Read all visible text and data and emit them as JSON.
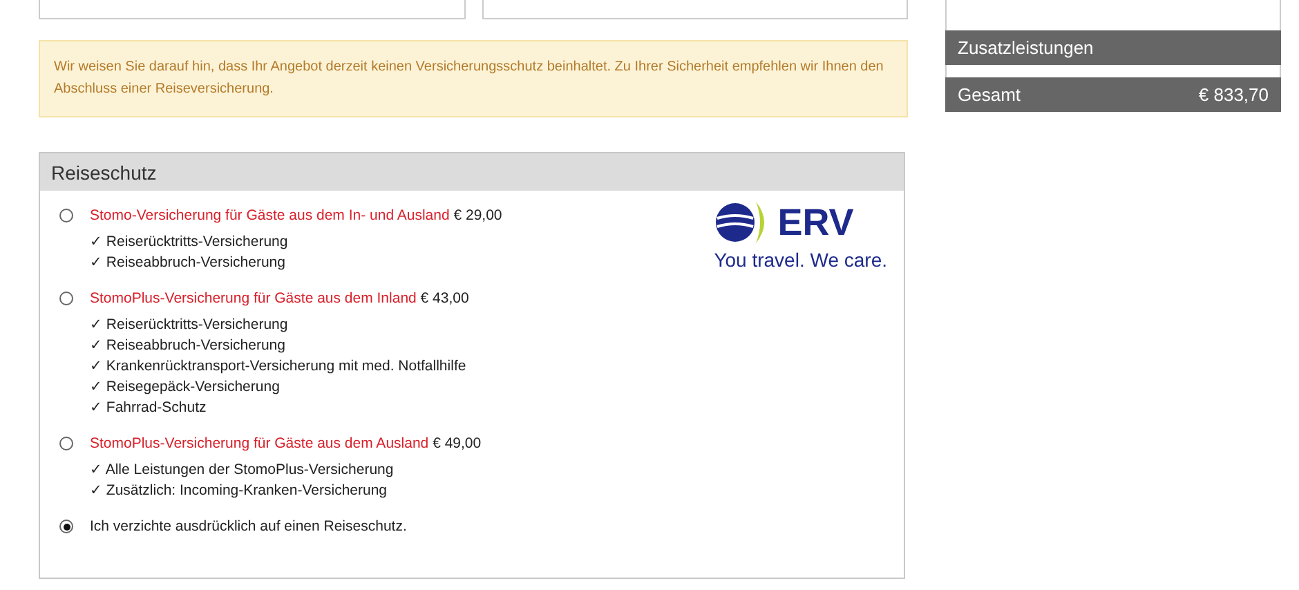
{
  "notice": "Wir weisen Sie darauf hin, dass Ihr Angebot derzeit keinen Versicherungsschutz beinhaltet. Zu Ihrer Sicherheit empfehlen wir Ihnen den Abschluss einer Reiseversicherung.",
  "panel": {
    "title": "Reiseschutz",
    "logo": {
      "name": "ERV",
      "slogan": "You travel. We care."
    },
    "options": [
      {
        "kind": "offer",
        "title": "Stomo-Versicherung für Gäste aus dem In- und Ausland",
        "price": "€ 29,00",
        "selected": false,
        "features": [
          "✓ Reiserücktritts-Versicherung",
          "✓ Reiseabbruch-Versicherung"
        ]
      },
      {
        "kind": "offer",
        "title": "StomoPlus-Versicherung für Gäste aus dem Inland",
        "price": "€ 43,00",
        "selected": false,
        "features": [
          "✓ Reiserücktritts-Versicherung",
          "✓ Reiseabbruch-Versicherung",
          "✓ Krankenrücktransport-Versicherung mit med. Notfallhilfe",
          "✓ Reisegepäck-Versicherung",
          "✓ Fahrrad-Schutz"
        ]
      },
      {
        "kind": "offer",
        "title": "StomoPlus-Versicherung für Gäste aus dem Ausland",
        "price": "€ 49,00",
        "selected": false,
        "features": [
          "✓ Alle Leistungen der StomoPlus-Versicherung",
          "✓ Zusätzlich: Incoming-Kranken-Versicherung"
        ]
      },
      {
        "kind": "waiver",
        "title": "Ich verzichte ausdrücklich auf einen Reiseschutz.",
        "selected": true
      }
    ]
  },
  "sidebar": {
    "section": "Zusatzleistungen",
    "total_label": "Gesamt",
    "total_value": "€ 833,70"
  }
}
